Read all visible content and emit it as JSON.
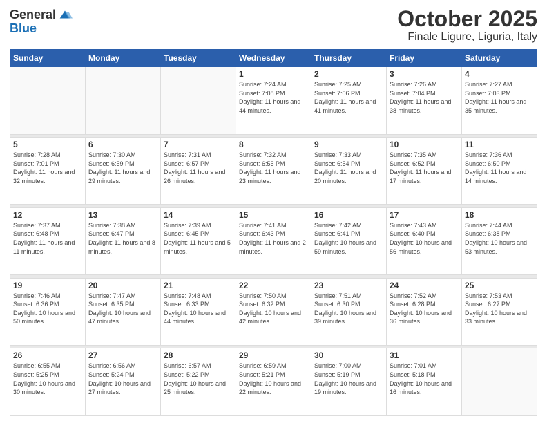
{
  "header": {
    "logo_general": "General",
    "logo_blue": "Blue",
    "month": "October 2025",
    "location": "Finale Ligure, Liguria, Italy"
  },
  "days_of_week": [
    "Sunday",
    "Monday",
    "Tuesday",
    "Wednesday",
    "Thursday",
    "Friday",
    "Saturday"
  ],
  "weeks": [
    [
      {
        "day": "",
        "info": ""
      },
      {
        "day": "",
        "info": ""
      },
      {
        "day": "",
        "info": ""
      },
      {
        "day": "1",
        "info": "Sunrise: 7:24 AM\nSunset: 7:08 PM\nDaylight: 11 hours\nand 44 minutes."
      },
      {
        "day": "2",
        "info": "Sunrise: 7:25 AM\nSunset: 7:06 PM\nDaylight: 11 hours\nand 41 minutes."
      },
      {
        "day": "3",
        "info": "Sunrise: 7:26 AM\nSunset: 7:04 PM\nDaylight: 11 hours\nand 38 minutes."
      },
      {
        "day": "4",
        "info": "Sunrise: 7:27 AM\nSunset: 7:03 PM\nDaylight: 11 hours\nand 35 minutes."
      }
    ],
    [
      {
        "day": "5",
        "info": "Sunrise: 7:28 AM\nSunset: 7:01 PM\nDaylight: 11 hours\nand 32 minutes."
      },
      {
        "day": "6",
        "info": "Sunrise: 7:30 AM\nSunset: 6:59 PM\nDaylight: 11 hours\nand 29 minutes."
      },
      {
        "day": "7",
        "info": "Sunrise: 7:31 AM\nSunset: 6:57 PM\nDaylight: 11 hours\nand 26 minutes."
      },
      {
        "day": "8",
        "info": "Sunrise: 7:32 AM\nSunset: 6:55 PM\nDaylight: 11 hours\nand 23 minutes."
      },
      {
        "day": "9",
        "info": "Sunrise: 7:33 AM\nSunset: 6:54 PM\nDaylight: 11 hours\nand 20 minutes."
      },
      {
        "day": "10",
        "info": "Sunrise: 7:35 AM\nSunset: 6:52 PM\nDaylight: 11 hours\nand 17 minutes."
      },
      {
        "day": "11",
        "info": "Sunrise: 7:36 AM\nSunset: 6:50 PM\nDaylight: 11 hours\nand 14 minutes."
      }
    ],
    [
      {
        "day": "12",
        "info": "Sunrise: 7:37 AM\nSunset: 6:48 PM\nDaylight: 11 hours\nand 11 minutes."
      },
      {
        "day": "13",
        "info": "Sunrise: 7:38 AM\nSunset: 6:47 PM\nDaylight: 11 hours\nand 8 minutes."
      },
      {
        "day": "14",
        "info": "Sunrise: 7:39 AM\nSunset: 6:45 PM\nDaylight: 11 hours\nand 5 minutes."
      },
      {
        "day": "15",
        "info": "Sunrise: 7:41 AM\nSunset: 6:43 PM\nDaylight: 11 hours\nand 2 minutes."
      },
      {
        "day": "16",
        "info": "Sunrise: 7:42 AM\nSunset: 6:41 PM\nDaylight: 10 hours\nand 59 minutes."
      },
      {
        "day": "17",
        "info": "Sunrise: 7:43 AM\nSunset: 6:40 PM\nDaylight: 10 hours\nand 56 minutes."
      },
      {
        "day": "18",
        "info": "Sunrise: 7:44 AM\nSunset: 6:38 PM\nDaylight: 10 hours\nand 53 minutes."
      }
    ],
    [
      {
        "day": "19",
        "info": "Sunrise: 7:46 AM\nSunset: 6:36 PM\nDaylight: 10 hours\nand 50 minutes."
      },
      {
        "day": "20",
        "info": "Sunrise: 7:47 AM\nSunset: 6:35 PM\nDaylight: 10 hours\nand 47 minutes."
      },
      {
        "day": "21",
        "info": "Sunrise: 7:48 AM\nSunset: 6:33 PM\nDaylight: 10 hours\nand 44 minutes."
      },
      {
        "day": "22",
        "info": "Sunrise: 7:50 AM\nSunset: 6:32 PM\nDaylight: 10 hours\nand 42 minutes."
      },
      {
        "day": "23",
        "info": "Sunrise: 7:51 AM\nSunset: 6:30 PM\nDaylight: 10 hours\nand 39 minutes."
      },
      {
        "day": "24",
        "info": "Sunrise: 7:52 AM\nSunset: 6:28 PM\nDaylight: 10 hours\nand 36 minutes."
      },
      {
        "day": "25",
        "info": "Sunrise: 7:53 AM\nSunset: 6:27 PM\nDaylight: 10 hours\nand 33 minutes."
      }
    ],
    [
      {
        "day": "26",
        "info": "Sunrise: 6:55 AM\nSunset: 5:25 PM\nDaylight: 10 hours\nand 30 minutes."
      },
      {
        "day": "27",
        "info": "Sunrise: 6:56 AM\nSunset: 5:24 PM\nDaylight: 10 hours\nand 27 minutes."
      },
      {
        "day": "28",
        "info": "Sunrise: 6:57 AM\nSunset: 5:22 PM\nDaylight: 10 hours\nand 25 minutes."
      },
      {
        "day": "29",
        "info": "Sunrise: 6:59 AM\nSunset: 5:21 PM\nDaylight: 10 hours\nand 22 minutes."
      },
      {
        "day": "30",
        "info": "Sunrise: 7:00 AM\nSunset: 5:19 PM\nDaylight: 10 hours\nand 19 minutes."
      },
      {
        "day": "31",
        "info": "Sunrise: 7:01 AM\nSunset: 5:18 PM\nDaylight: 10 hours\nand 16 minutes."
      },
      {
        "day": "",
        "info": ""
      }
    ]
  ]
}
